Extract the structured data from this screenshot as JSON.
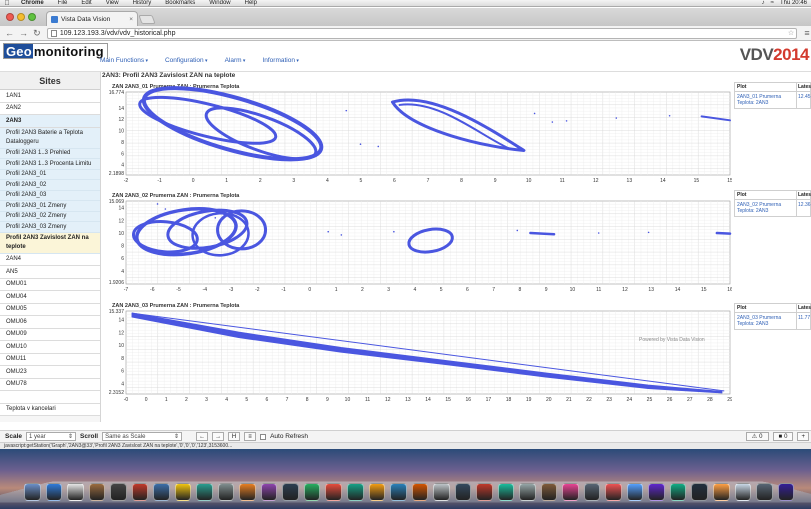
{
  "menubar": {
    "app": "Chrome",
    "items": [
      "File",
      "Edit",
      "View",
      "History",
      "Bookmarks",
      "Window",
      "Help"
    ],
    "clock": "Thu 20:46"
  },
  "browser": {
    "tab_title": "Vista Data Vision",
    "url": "109.123.193.3/vdv/vdv_historical.php"
  },
  "header": {
    "logo_geo": "Geo",
    "logo_rest": "monitoring",
    "nav": [
      "Main Functions",
      "Configuration",
      "Alarm",
      "Information"
    ],
    "brand": "VDV",
    "brand_year": "2014"
  },
  "sidebar": {
    "title": "Sites",
    "sites_top": [
      "1AN1",
      "2AN2"
    ],
    "group": "2AN3",
    "group_items": [
      "Profil 2AN3 Baterie a Teplota Dataloggeru",
      "Profil 2AN3 1..3 Prehled",
      "Profil 2AN3 1..3 Procenta Limitu",
      "Profil 2AN3_01",
      "Profil 2AN3_02",
      "Profil 2AN3_03",
      "Profil 2AN3_01 Zmeny",
      "Profil 2AN3_02 Zmeny",
      "Profil 2AN3_03 Zmeny"
    ],
    "active_item": "Profil 2AN3 Zavislost ZAN na teplote",
    "sites_bottom": [
      "2AN4",
      "AN5",
      "OMU01",
      "OMU04",
      "OMU05",
      "OMU06",
      "OMU09",
      "OMU10",
      "OMU11",
      "OMU23",
      "OMU78",
      "",
      "Teplota v kancelari"
    ]
  },
  "main": {
    "page_title": "2AN3: Profil 2AN3 Zavislost ZAN na teplote",
    "powered_by": "Powered by Vista Data Vision",
    "side_panels": [
      {
        "h1": "Plot",
        "h2": "Latest",
        "link": "2AN3_01 Prumerna Teplota: 2AN3",
        "value": "12.45"
      },
      {
        "h1": "Plot",
        "h2": "Latest",
        "link": "2AN3_02 Prumerna Teplota: 2AN3",
        "value": "12.36"
      },
      {
        "h1": "Plot",
        "h2": "Latest",
        "link": "2AN3_03 Prumerna Teplota: 2AN3",
        "value": "11.77"
      }
    ]
  },
  "chart_data": [
    {
      "type": "scatter",
      "title": "ZAN 2AN3_01 Prumerna ZAN : Prumerna Teplota",
      "ymax_label": "16.774",
      "ymin_label": "2.1898",
      "xticks": [
        "-2",
        "-1",
        "0",
        "1",
        "2",
        "3",
        "4",
        "5",
        "6",
        "7",
        "8",
        "9",
        "10",
        "11",
        "12",
        "13",
        "14",
        "15",
        "15"
      ],
      "yticks": [
        "14",
        "12",
        "10",
        "8",
        "6",
        "4"
      ],
      "xlim": [
        -2,
        15
      ],
      "ylim": [
        2.1898,
        16.774
      ],
      "color": "#4a56e0"
    },
    {
      "type": "scatter",
      "title": "ZAN 2AN3_02 Prumerna ZAN : Prumerna Teplota",
      "ymax_label": "15.069",
      "ymin_label": "1.9206",
      "xticks": [
        "-7",
        "-6",
        "-5",
        "-4",
        "-3",
        "-2",
        "-1",
        "0",
        "1",
        "2",
        "3",
        "4",
        "5",
        "6",
        "7",
        "8",
        "9",
        "10",
        "11",
        "12",
        "13",
        "14",
        "15",
        "16"
      ],
      "yticks": [
        "14",
        "12",
        "10",
        "8",
        "6",
        "4"
      ],
      "xlim": [
        -7,
        16
      ],
      "ylim": [
        1.9206,
        15.069
      ],
      "color": "#4a56e0"
    },
    {
      "type": "scatter",
      "title": "ZAN 2AN3_03 Prumerna ZAN : Prumerna Teplota",
      "ymax_label": "15.337",
      "ymin_label": "2.3152",
      "xticks": [
        "-0",
        "0",
        "1",
        "2",
        "3",
        "4",
        "5",
        "6",
        "7",
        "8",
        "9",
        "10",
        "11",
        "12",
        "13",
        "14",
        "15",
        "16",
        "17",
        "18",
        "19",
        "20",
        "21",
        "22",
        "23",
        "24",
        "25",
        "26",
        "27",
        "28",
        "29"
      ],
      "yticks": [
        "14",
        "12",
        "10",
        "8",
        "6",
        "4"
      ],
      "xlim": [
        -0.5,
        29
      ],
      "ylim": [
        2.3152,
        15.337
      ],
      "color": "#4a56e0"
    }
  ],
  "bottombar": {
    "scale_label": "Scale",
    "scale_value": "1 year",
    "scroll_label": "Scroll",
    "scroll_value": "Same as Scale",
    "nav_buttons": [
      "←",
      "→",
      "H",
      "≡"
    ],
    "auto_refresh": "Auto Refresh",
    "alarms": "0",
    "messages": "0"
  },
  "status_text": "javascript:getStation('Graph','2AN3@33','Profil 2AN3 Zavislost ZAN na teplote','0','0','0','123',3153600..."
}
